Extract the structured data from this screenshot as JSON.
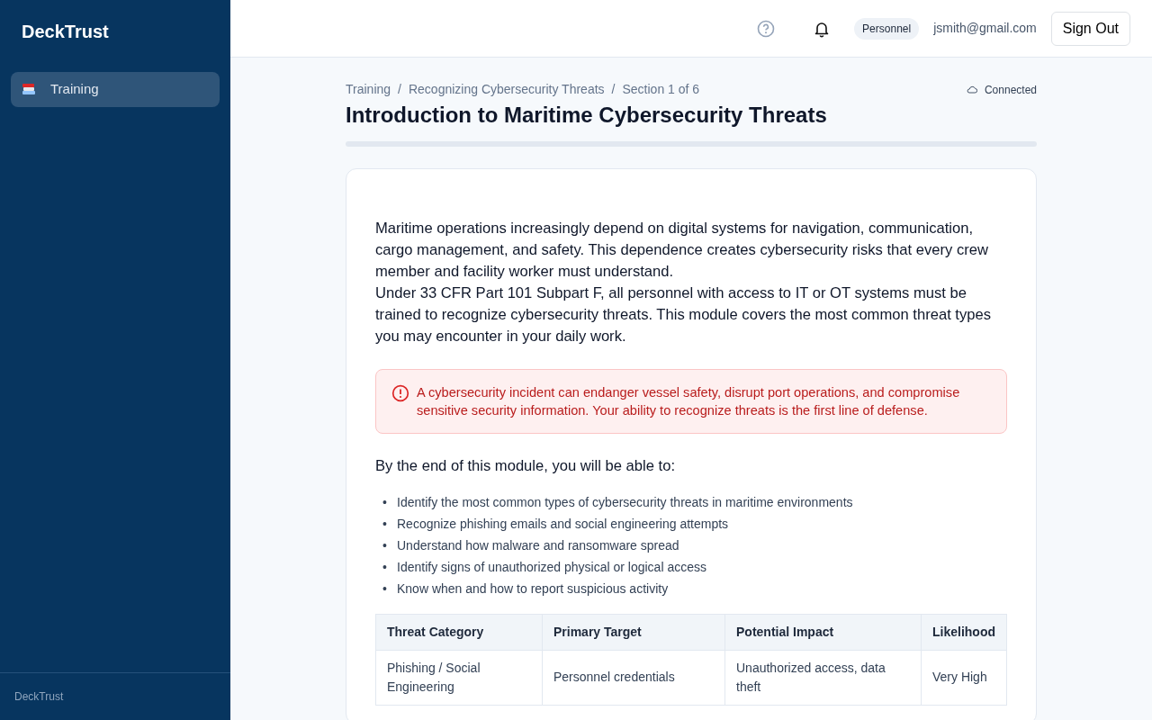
{
  "sidebar": {
    "brand": "DeckTrust",
    "items": [
      {
        "label": "Training",
        "selected": true
      }
    ],
    "footer": "DeckTrust"
  },
  "header": {
    "role_badge": "Personnel",
    "email": "jsmith@gmail.com",
    "sign_out": "Sign Out"
  },
  "breadcrumb": [
    "Training",
    "Recognizing Cybersecurity Threats",
    "Section 1 of 6"
  ],
  "breadcrumb_separator": "/",
  "list_marker": "•",
  "connection": "Connected",
  "title": "Introduction to Maritime Cybersecurity Threats",
  "progress": {
    "level": 0
  },
  "paragraphs": [
    "Maritime operations increasingly depend on digital systems for navigation, communication, cargo management, and safety. This dependence creates cybersecurity risks that every crew member and facility worker must understand.",
    "Under 33 CFR Part 101 Subpart F, all personnel with access to IT or OT systems must be trained to recognize cybersecurity threats. This module covers the most common threat types you may encounter in your daily work."
  ],
  "alert": "A cybersecurity incident can endanger vessel safety, disrupt port operations, and compromise sensitive security information. Your ability to recognize threats is the first line of defense.",
  "objectives_heading": "By the end of this module, you will be able to:",
  "objectives": [
    "Identify the most common types of cybersecurity threats in maritime environments",
    "Recognize phishing emails and social engineering attempts",
    "Understand how malware and ransomware spread",
    "Identify signs of unauthorized physical or logical access",
    "Know when and how to report suspicious activity"
  ],
  "table": {
    "columns": [
      "Threat Category",
      "Primary Target",
      "Potential Impact",
      "Likelihood"
    ],
    "rows": [
      [
        "Phishing / Social Engineering",
        "Personnel credentials",
        "Unauthorized access, data theft",
        "Very High"
      ]
    ]
  }
}
